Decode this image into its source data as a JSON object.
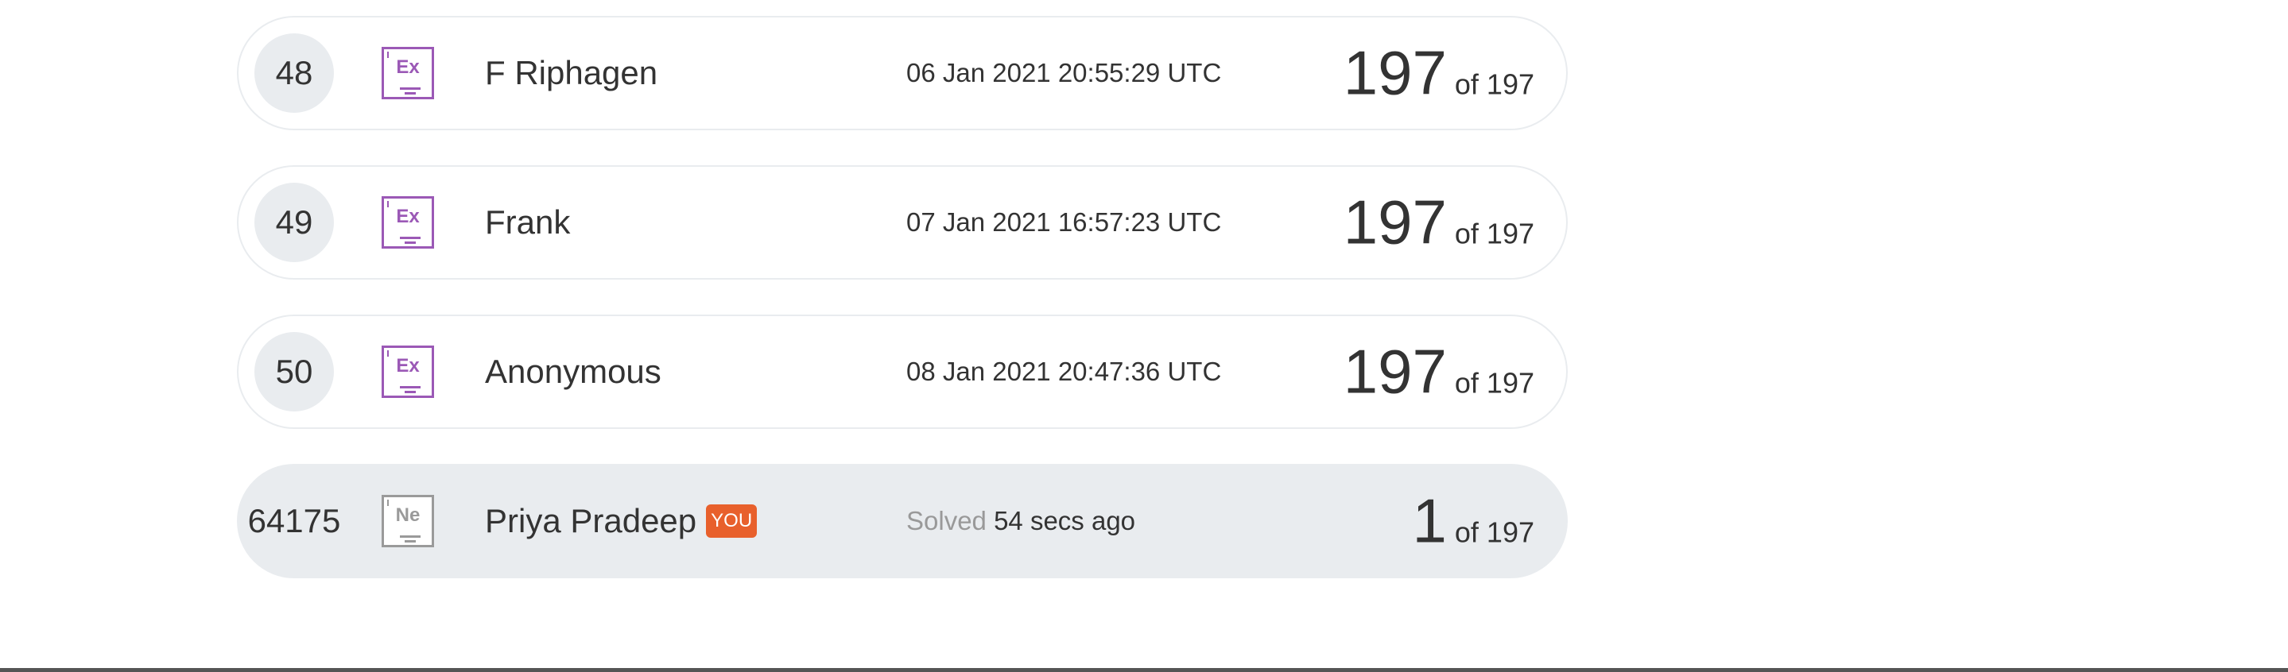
{
  "leaderboard": {
    "rows": [
      {
        "rank": "48",
        "badge": "Ex",
        "name": "F Riphagen",
        "time": "06 Jan 2021 20:55:29 UTC",
        "score": "197",
        "of_label": "of 197"
      },
      {
        "rank": "49",
        "badge": "Ex",
        "name": "Frank",
        "time": "07 Jan 2021 16:57:23 UTC",
        "score": "197",
        "of_label": "of 197"
      },
      {
        "rank": "50",
        "badge": "Ex",
        "name": "Anonymous",
        "time": "08 Jan 2021 20:47:36 UTC",
        "score": "197",
        "of_label": "of 197"
      }
    ],
    "current_user": {
      "rank": "64175",
      "badge": "Ne",
      "name": "Priya Pradeep",
      "you_label": "YOU",
      "solved_label": "Solved",
      "time": "54 secs ago",
      "score": "1",
      "of_label": "of 197"
    }
  },
  "colors": {
    "expert_badge": "#9b59b6",
    "newbie_badge": "#9a9a9a",
    "you_badge": "#e8602c",
    "row_border": "#e9ecef",
    "current_row_bg": "#e9ecef"
  },
  "icons": {
    "expert": "expert-rank-badge-icon",
    "newbie": "newbie-rank-badge-icon"
  }
}
